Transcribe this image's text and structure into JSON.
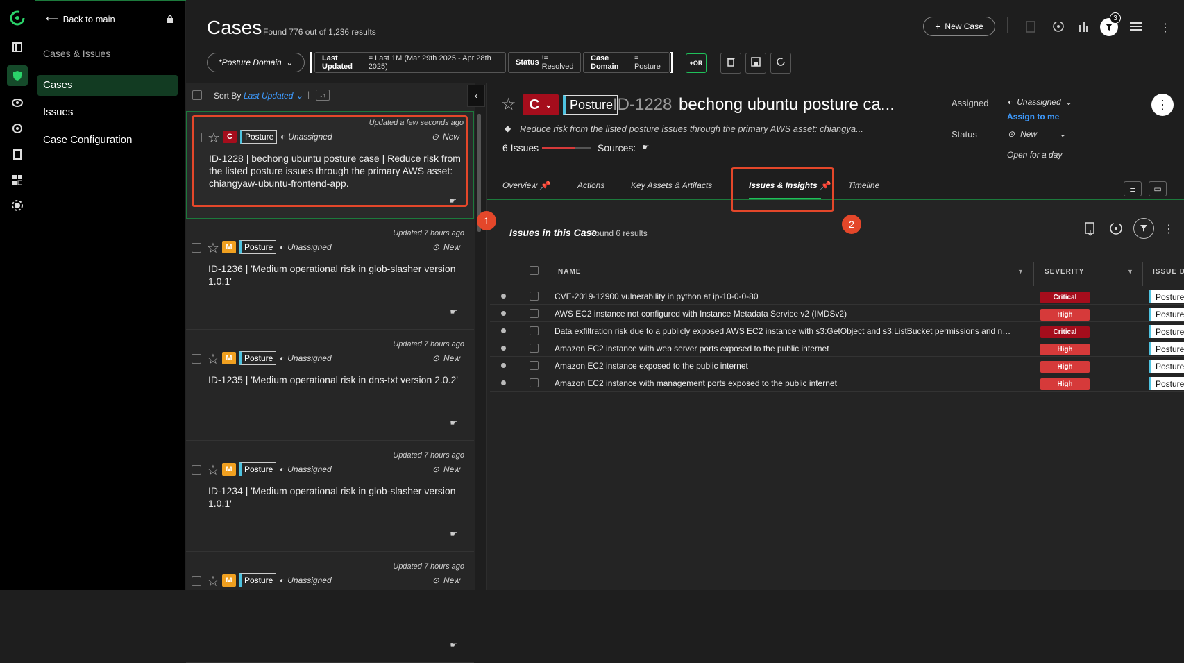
{
  "nav": {
    "back_label": "Back to main",
    "section_title": "Cases & Issues",
    "items": [
      {
        "label": "Cases",
        "active": true
      },
      {
        "label": "Issues",
        "active": false
      },
      {
        "label": "Case Configuration",
        "active": false
      }
    ]
  },
  "header": {
    "title": "Cases",
    "found": "Found 776 out of 1,236 results",
    "new_case": "New Case",
    "filter_count": "3"
  },
  "filters": {
    "domain_dropdown": "*Posture Domain",
    "chips": [
      {
        "field": "Last Updated",
        "value": "= Last 1M (Mar 29th 2025 - Apr 28th 2025)"
      },
      {
        "field": "Status",
        "value": "!= Resolved"
      },
      {
        "field": "Case Domain",
        "value": "= Posture"
      }
    ],
    "or_label": "+OR"
  },
  "list": {
    "sort_by": "Sort By",
    "sort_field": "Last Updated",
    "cards": [
      {
        "updated": "Updated a few seconds ago",
        "sev": "C",
        "domain": "Posture",
        "assignee": "Unassigned",
        "status": "New",
        "text": "ID-1228 | bechong ubuntu posture case | Reduce risk from the listed posture issues through the primary AWS asset: chiangyaw-ubuntu-frontend-app."
      },
      {
        "updated": "Updated 7 hours ago",
        "sev": "M",
        "domain": "Posture",
        "assignee": "Unassigned",
        "status": "New",
        "text": "ID-1236 | 'Medium operational risk in glob-slasher version 1.0.1'"
      },
      {
        "updated": "Updated 7 hours ago",
        "sev": "M",
        "domain": "Posture",
        "assignee": "Unassigned",
        "status": "New",
        "text": "ID-1235 | 'Medium operational risk in dns-txt version 2.0.2'"
      },
      {
        "updated": "Updated 7 hours ago",
        "sev": "M",
        "domain": "Posture",
        "assignee": "Unassigned",
        "status": "New",
        "text": "ID-1234 | 'Medium operational risk in glob-slasher version 1.0.1'"
      },
      {
        "updated": "Updated 7 hours ago",
        "sev": "M",
        "domain": "Posture",
        "assignee": "Unassigned",
        "status": "New",
        "text": ""
      }
    ]
  },
  "detail": {
    "sev": "C",
    "domain": "Posture",
    "id": "ID-1228",
    "title": "bechong ubuntu posture ca...",
    "subtitle": "Reduce risk from the listed posture issues through the primary AWS asset: chiangya...",
    "issues_count": "6 Issues",
    "sources_label": "Sources:",
    "assigned_label": "Assigned",
    "assigned_value": "Unassigned",
    "assign_to_me": "Assign to me",
    "status_label": "Status",
    "status_value": "New",
    "open_for": "Open for a day",
    "tabs": [
      "Overview",
      "Actions",
      "Key Assets & Artifacts",
      "Issues & Insights",
      "Timeline"
    ],
    "issues_title": "Issues in this Case",
    "issues_found": "Found 6 results",
    "columns": [
      "NAME",
      "SEVERITY",
      "ISSUE D"
    ],
    "rows": [
      {
        "name": "CVE-2019-12900 vulnerability in python at ip-10-0-0-80",
        "severity": "Critical",
        "domain": "Posture"
      },
      {
        "name": "AWS EC2 instance not configured with Instance Metadata Service v2 (IMDSv2)",
        "severity": "High",
        "domain": "Posture"
      },
      {
        "name": "Data exfiltration risk due to a publicly exposed AWS EC2 instance with s3:GetObject and s3:ListBucket permissions and not con...",
        "severity": "Critical",
        "domain": "Posture"
      },
      {
        "name": "Amazon EC2 instance with web server ports exposed to the public internet",
        "severity": "High",
        "domain": "Posture"
      },
      {
        "name": "Amazon EC2 instance exposed to the public internet",
        "severity": "High",
        "domain": "Posture"
      },
      {
        "name": "Amazon EC2 instance with management ports exposed to the public internet",
        "severity": "High",
        "domain": "Posture"
      }
    ]
  },
  "annotations": [
    "1",
    "2"
  ],
  "colors": {
    "accent": "#1fc15a",
    "critical": "#a50d1c",
    "high": "#d63a3a",
    "medium": "#f0a020",
    "link": "#3e9bff"
  }
}
